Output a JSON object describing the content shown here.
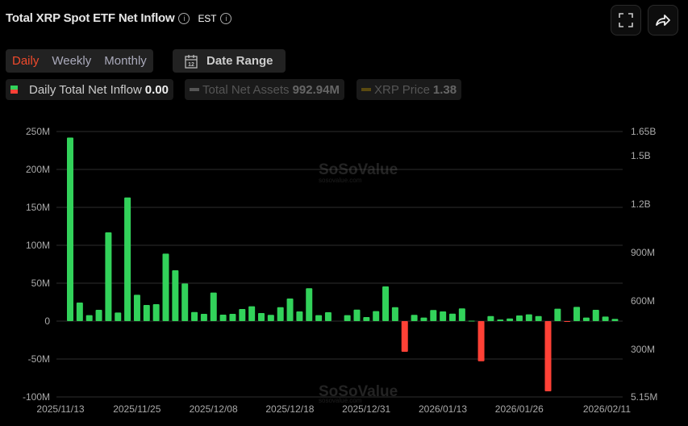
{
  "header": {
    "title": "Total XRP Spot ETF Net Inflow",
    "timezone": "EST",
    "info_icon": "info-circle-icon",
    "fullscreen_icon": "fullscreen-icon",
    "share_icon": "share-icon"
  },
  "controls": {
    "periods": [
      "Daily",
      "Weekly",
      "Monthly"
    ],
    "active_period": "Daily",
    "date_range_label": "Date Range",
    "date_range_icon": "calendar-icon"
  },
  "legend": [
    {
      "label": "Daily Total Net Inflow",
      "value": "0.00",
      "active": true
    },
    {
      "label": "Total Net Assets",
      "value": "992.94M",
      "active": false
    },
    {
      "label": "XRP Price",
      "value": "1.38",
      "active": false
    }
  ],
  "watermark": {
    "brand": "SoSoValue",
    "site": "sosovalue.com"
  },
  "colors": {
    "positive": "#32d25a",
    "negative": "#ff4136",
    "accent": "#f04a2c",
    "grid": "#2e2e2e"
  },
  "chart_data": {
    "type": "bar",
    "title": "Total XRP Spot ETF Net Inflow",
    "categories": [
      "2025/11/13",
      "2025/11/14",
      "2025/11/17",
      "2025/11/18",
      "2025/11/19",
      "2025/11/20",
      "2025/11/21",
      "2025/11/24",
      "2025/11/25",
      "2025/11/26",
      "2025/11/28",
      "2025/12/01",
      "2025/12/02",
      "2025/12/03",
      "2025/12/04",
      "2025/12/05",
      "2025/12/08",
      "2025/12/09",
      "2025/12/10",
      "2025/12/11",
      "2025/12/12",
      "2025/12/15",
      "2025/12/16",
      "2025/12/17",
      "2025/12/18",
      "2025/12/19",
      "2025/12/22",
      "2025/12/23",
      "2025/12/24",
      "2025/12/26",
      "2025/12/29",
      "2025/12/30",
      "2025/12/31",
      "2026/01/02",
      "2026/01/05",
      "2026/01/06",
      "2026/01/07",
      "2026/01/08",
      "2026/01/09",
      "2026/01/12",
      "2026/01/13",
      "2026/01/14",
      "2026/01/15",
      "2026/01/16",
      "2026/01/20",
      "2026/01/21",
      "2026/01/22",
      "2026/01/23",
      "2026/01/26",
      "2026/01/27",
      "2026/01/28",
      "2026/01/29",
      "2026/01/30",
      "2026/02/02",
      "2026/02/03",
      "2026/02/04",
      "2026/02/05",
      "2026/02/06"
    ],
    "series": [
      {
        "name": "Daily Total Net Inflow",
        "values": [
          242,
          24.5,
          7.8,
          14.9,
          117,
          11.3,
          163,
          34.7,
          21.3,
          22.3,
          89,
          67,
          49.6,
          12,
          9.6,
          37.6,
          8.5,
          9.6,
          16,
          19.5,
          10.6,
          8.2,
          18.4,
          29.8,
          12.8,
          43.3,
          7.8,
          11.7,
          0,
          7.8,
          15.2,
          5.3,
          13.1,
          45.7,
          18.4,
          -40.4,
          8.2,
          4.6,
          14.6,
          12.8,
          9.9,
          16.7,
          0.5,
          -52.9,
          6.7,
          2.1,
          3.5,
          7.4,
          8.9,
          6.7,
          -92.6,
          16.3,
          -0.5,
          18.8,
          4.6,
          14.9,
          6,
          2.9
        ]
      }
    ],
    "x_tick_labels": [
      "2025/11/13",
      "2025/11/25",
      "2025/12/08",
      "2025/12/18",
      "2025/12/31",
      "2026/01/13",
      "2026/01/26",
      "2026/02/11"
    ],
    "y_left": {
      "ticks": [
        "250M",
        "200M",
        "150M",
        "100M",
        "50M",
        "0",
        "-50M",
        "-100M"
      ],
      "range": [
        -100,
        250
      ],
      "unit": "M"
    },
    "y_right": {
      "ticks": [
        "1.65B",
        "1.5B",
        "1.2B",
        "900M",
        "600M",
        "300M",
        "5.15M"
      ]
    },
    "grid": true
  }
}
